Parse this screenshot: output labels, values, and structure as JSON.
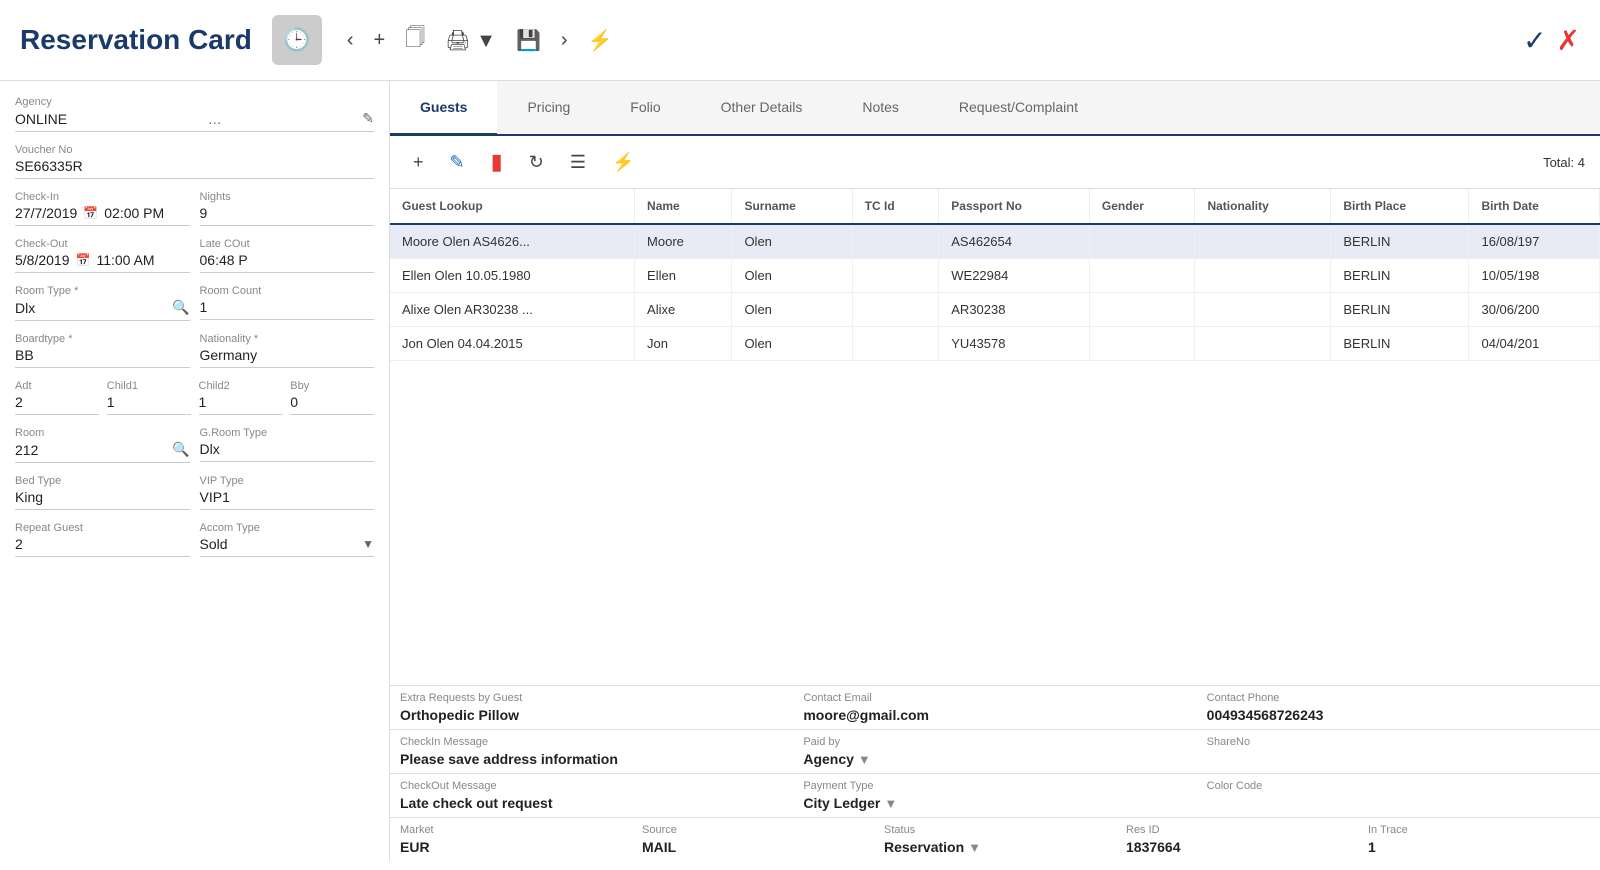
{
  "header": {
    "title": "Reservation Card",
    "confirm_label": "✓",
    "cancel_label": "✗"
  },
  "left_panel": {
    "agency_label": "Agency",
    "agency_value": "ONLINE",
    "voucher_label": "Voucher No",
    "voucher_value": "SE66335R",
    "checkin_label": "Check-In",
    "checkin_value": "27/7/2019",
    "checkin_time": "02:00 PM",
    "nights_label": "Nights",
    "nights_value": "9",
    "checkout_label": "Check-Out",
    "checkout_value": "5/8/2019",
    "checkout_time": "11:00 AM",
    "late_cout_label": "Late COut",
    "late_cout_value": "06:48 P",
    "room_type_label": "Room Type *",
    "room_type_value": "Dlx",
    "room_count_label": "Room Count",
    "room_count_value": "1",
    "boardtype_label": "Boardtype *",
    "boardtype_value": "BB",
    "nationality_label": "Nationality *",
    "nationality_value": "Germany",
    "adt_label": "Adt",
    "adt_value": "2",
    "child1_label": "Child1",
    "child1_value": "1",
    "child2_label": "Child2",
    "child2_value": "1",
    "bby_label": "Bby",
    "bby_value": "0",
    "room_label": "Room",
    "room_value": "212",
    "groom_type_label": "G.Room Type",
    "groom_type_value": "Dlx",
    "bed_type_label": "Bed Type",
    "bed_type_value": "King",
    "vip_type_label": "VIP Type",
    "vip_type_value": "VIP1",
    "repeat_guest_label": "Repeat Guest",
    "repeat_guest_value": "2",
    "accom_type_label": "Accom Type",
    "accom_type_value": "Sold"
  },
  "tabs": [
    {
      "id": "guests",
      "label": "Guests",
      "active": true
    },
    {
      "id": "pricing",
      "label": "Pricing",
      "active": false
    },
    {
      "id": "folio",
      "label": "Folio",
      "active": false
    },
    {
      "id": "other-details",
      "label": "Other Details",
      "active": false
    },
    {
      "id": "notes",
      "label": "Notes",
      "active": false
    },
    {
      "id": "request-complaint",
      "label": "Request/Complaint",
      "active": false
    }
  ],
  "guests_tab": {
    "total_label": "Total: 4",
    "columns": [
      "Guest Lookup",
      "Name",
      "Surname",
      "TC Id",
      "Passport No",
      "Gender",
      "Nationality",
      "Birth Place",
      "Birth Date"
    ],
    "rows": [
      {
        "guest_lookup": "Moore Olen AS4626...",
        "name": "Moore",
        "surname": "Olen",
        "tc_id": "",
        "passport_no": "AS462654",
        "gender": "",
        "nationality": "",
        "birth_place": "BERLIN",
        "birth_date": "16/08/197"
      },
      {
        "guest_lookup": "Ellen Olen 10.05.1980",
        "name": "Ellen",
        "surname": "Olen",
        "tc_id": "",
        "passport_no": "WE22984",
        "gender": "",
        "nationality": "",
        "birth_place": "BERLIN",
        "birth_date": "10/05/198"
      },
      {
        "guest_lookup": "Alixe Olen AR30238 ...",
        "name": "Alixe",
        "surname": "Olen",
        "tc_id": "",
        "passport_no": "AR30238",
        "gender": "",
        "nationality": "",
        "birth_place": "BERLIN",
        "birth_date": "30/06/200"
      },
      {
        "guest_lookup": "Jon Olen 04.04.2015",
        "name": "Jon",
        "surname": "Olen",
        "tc_id": "",
        "passport_no": "YU43578",
        "gender": "",
        "nationality": "",
        "birth_place": "BERLIN",
        "birth_date": "04/04/201"
      }
    ]
  },
  "bottom_info": {
    "extra_requests_label": "Extra Requests by Guest",
    "extra_requests_value": "Orthopedic Pillow",
    "contact_email_label": "Contact Email",
    "contact_email_value": "moore@gmail.com",
    "contact_phone_label": "Contact Phone",
    "contact_phone_value": "004934568726243",
    "checkin_msg_label": "CheckIn Message",
    "checkin_msg_value": "Please save address information",
    "paid_by_label": "Paid by",
    "paid_by_value": "Agency",
    "share_no_label": "ShareNo",
    "share_no_value": "",
    "checkout_msg_label": "CheckOut Message",
    "checkout_msg_value": "Late check out request",
    "payment_type_label": "Payment Type",
    "payment_type_value": "City Ledger",
    "color_code_label": "Color Code",
    "color_code_value": "",
    "market_label": "Market",
    "market_value": "EUR",
    "source_label": "Source",
    "source_value": "MAIL",
    "status_label": "Status",
    "status_value": "Reservation",
    "res_id_label": "Res ID",
    "res_id_value": "1837664",
    "in_trace_label": "In Trace",
    "in_trace_value": "1"
  }
}
